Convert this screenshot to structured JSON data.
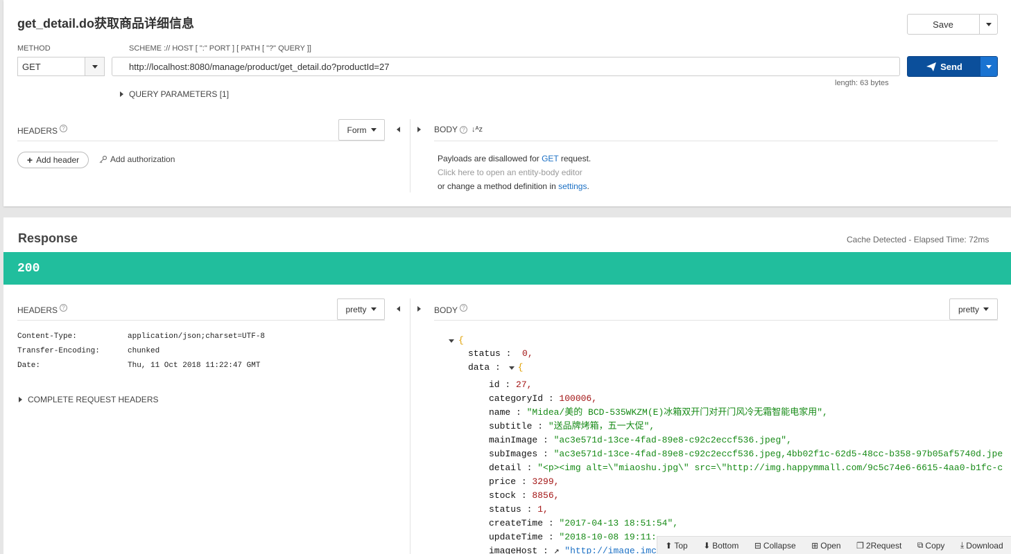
{
  "request": {
    "title": "get_detail.do获取商品详细信息",
    "save_label": "Save",
    "method_label": "METHOD",
    "method_value": "GET",
    "url_label": "SCHEME :// HOST [ \":\" PORT ] [ PATH [ \"?\" QUERY ]]",
    "url_value": "http://localhost:8080/manage/product/get_detail.do?productId=27",
    "send_label": "Send",
    "length_text": "length: 63 bytes",
    "query_params_label": "QUERY PARAMETERS [1]",
    "headers_label": "HEADERS",
    "form_label": "Form",
    "body_label": "BODY",
    "add_header_label": "Add header",
    "add_auth_label": "Add authorization",
    "payload_line1_a": "Payloads are disallowed for ",
    "payload_line1_b": "GET",
    "payload_line1_c": " request.",
    "payload_line2": "Click here to open an entity-body editor",
    "payload_line3_a": "or change a method definition in ",
    "payload_line3_b": "settings",
    "payload_line3_c": "."
  },
  "response": {
    "title": "Response",
    "cache_text": "Cache Detected - Elapsed Time: 72ms",
    "status_code": "200",
    "status_color": "#21be9d",
    "headers_label": "HEADERS",
    "pretty_label": "pretty",
    "body_label": "BODY",
    "headers": [
      {
        "name": "Content-Type:",
        "value": "application/json;charset=UTF-8"
      },
      {
        "name": "Transfer-Encoding:",
        "value": "chunked"
      },
      {
        "name": "Date:",
        "value": "Thu, 11 Oct 2018 11:22:47 GMT"
      }
    ],
    "complete_headers_label": "COMPLETE REQUEST HEADERS",
    "json": {
      "open_brace": "{",
      "status_key": "status",
      "status_val": "0,",
      "data_key": "data",
      "data_brace": "{",
      "fields": [
        {
          "key": "id",
          "val": "27,",
          "kind": "num"
        },
        {
          "key": "categoryId",
          "val": "100006,",
          "kind": "num"
        },
        {
          "key": "name",
          "val": "\"Midea/美的 BCD-535WKZM(E)冰箱双开门对开门风冷无霜智能电家用\",",
          "kind": "str"
        },
        {
          "key": "subtitle",
          "val": "\"送品牌烤箱，五一大促\",",
          "kind": "str"
        },
        {
          "key": "mainImage",
          "val": "\"ac3e571d-13ce-4fad-89e8-c92c2eccf536.jpeg\",",
          "kind": "str"
        },
        {
          "key": "subImages",
          "val": "\"ac3e571d-13ce-4fad-89e8-c92c2eccf536.jpeg,4bb02f1c-62d5-48cc-b358-97b05af5740d.jpe",
          "kind": "str"
        },
        {
          "key": "detail",
          "val": "\"<p><img alt=\\\"miaoshu.jpg\\\" src=\\\"http://img.happymmall.com/9c5c74e6-6615-4aa0-b1fc-c",
          "kind": "str"
        },
        {
          "key": "price",
          "val": "3299,",
          "kind": "num"
        },
        {
          "key": "stock",
          "val": "8856,",
          "kind": "num"
        },
        {
          "key": "status",
          "val": "1,",
          "kind": "num"
        },
        {
          "key": "createTime",
          "val": "\"2017-04-13 18:51:54\",",
          "kind": "str"
        },
        {
          "key": "updateTime",
          "val": "\"2018-10-08 19:11:",
          "kind": "str"
        },
        {
          "key": "imageHost",
          "val": "\"http://image.imc",
          "kind": "link"
        }
      ]
    },
    "toolbar": {
      "top": "Top",
      "bottom": "Bottom",
      "collapse": "Collapse",
      "open": "Open",
      "request": "2Request",
      "copy": "Copy",
      "download": "Download"
    }
  }
}
